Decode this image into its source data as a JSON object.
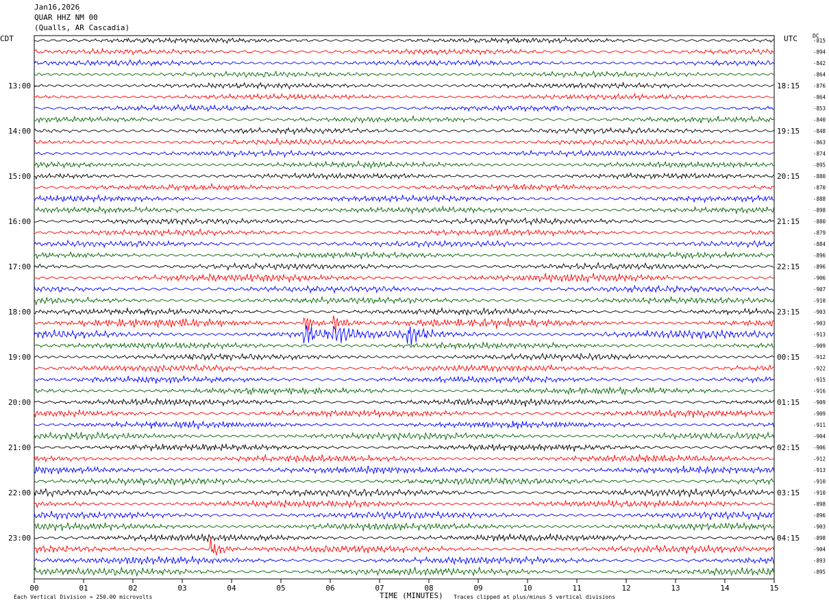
{
  "header": {
    "date": "Jan16,2026",
    "station": "QUAR HHZ NM 00",
    "location": "(Qualls, AR Cascadia)"
  },
  "left_timezone": "CDT",
  "right_timezone": "UTC",
  "dc_label": "DC",
  "footer": {
    "scale_note": "Each Vertical Division =  250.00 microvolts",
    "x_axis_title": "TIME (MINUTES)",
    "clip_note": "Traces clipped at plus/minus 5 vertical divisions"
  },
  "colors": {
    "trace_cycle": [
      "#000000",
      "#ff0000",
      "#0000ff",
      "#006400"
    ],
    "frame": "#000000",
    "background": "#ffffff"
  },
  "chart_data": {
    "type": "line",
    "x_label": "TIME (MINUTES)",
    "x_ticks": [
      "00",
      "01",
      "02",
      "03",
      "04",
      "05",
      "06",
      "07",
      "08",
      "09",
      "10",
      "11",
      "12",
      "13",
      "14",
      "15"
    ],
    "xlim": [
      0,
      15
    ],
    "trace_count": 48,
    "left_hour_labels": [
      "13:00",
      "14:00",
      "15:00",
      "16:00",
      "17:00",
      "18:00",
      "19:00",
      "20:00",
      "21:00",
      "22:00",
      "23:00"
    ],
    "right_hour_labels": [
      "18:15",
      "19:15",
      "20:15",
      "21:15",
      "22:15",
      "23:15",
      "00:15",
      "01:15",
      "02:15",
      "03:15",
      "04:15"
    ],
    "hour_label_first_trace": 4,
    "hour_label_every": 4,
    "dc_offsets": [
      "-815",
      "-894",
      "-842",
      "-864",
      "-876",
      "-864",
      "-853",
      "-840",
      "-848",
      "-863",
      "-874",
      "-895",
      "-880",
      "-870",
      "-888",
      "-898",
      "-880",
      "-879",
      "-884",
      "-896",
      "-896",
      "-906",
      "-907",
      "-910",
      "-903",
      "-903",
      "-913",
      "-909",
      "-912",
      "-922",
      "-915",
      "-916",
      "-909",
      "-909",
      "-911",
      "-904",
      "-906",
      "-912",
      "-913",
      "-910",
      "-910",
      "-898",
      "-896",
      "-903",
      "-898",
      "-904",
      "-893",
      "-895"
    ],
    "events": [
      {
        "trace": 25,
        "minute": 5.5
      },
      {
        "trace": 25,
        "minute": 6.1
      },
      {
        "trace": 26,
        "minute": 5.5
      },
      {
        "trace": 26,
        "minute": 6.1
      },
      {
        "trace": 26,
        "minute": 7.6
      },
      {
        "trace": 45,
        "minute": 3.6
      }
    ],
    "noisy_traces": [
      21,
      25,
      26
    ]
  }
}
